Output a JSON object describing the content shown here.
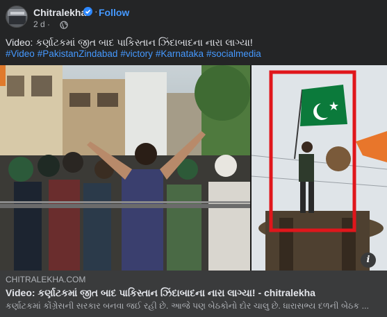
{
  "post": {
    "author": "Chitralekha",
    "follow_label": "Follow",
    "separator": "·",
    "time": "2 d ·",
    "caption": "Video: કર્ણાટકમાં જીત બાદ પાકિસ્તાન ઝિંદાબાદના નારા લાગ્યા!",
    "hashtags": [
      "#Video",
      "#PakistanZindabad",
      "#victory",
      "#Karnataka",
      "#socialmedia"
    ]
  },
  "media": {
    "info_label": "i"
  },
  "link_preview": {
    "domain": "CHITRALEKHA.COM",
    "title": "Video: કર્ણાટકમાં જીત બાદ પાકિસ્તાન ઝિંદાબાદના નારા લાગ્યા! - chitralekha",
    "description": "કર્ણાટકમાં કોંગ્રેસની સરકાર બનવા જઈ રહી છે. આજે પણ બેઠકોનો દોર ચાલુ છે. ધારાસભ્ય દળની બેઠક ..."
  },
  "colors": {
    "accent": "#4599ff",
    "verified": "#2d88ff",
    "highlight_box": "#e0161b",
    "flag_green": "#0b7a3b"
  },
  "icons": {
    "verified": "verified-badge-icon",
    "globe": "globe-icon",
    "info": "info-icon"
  }
}
